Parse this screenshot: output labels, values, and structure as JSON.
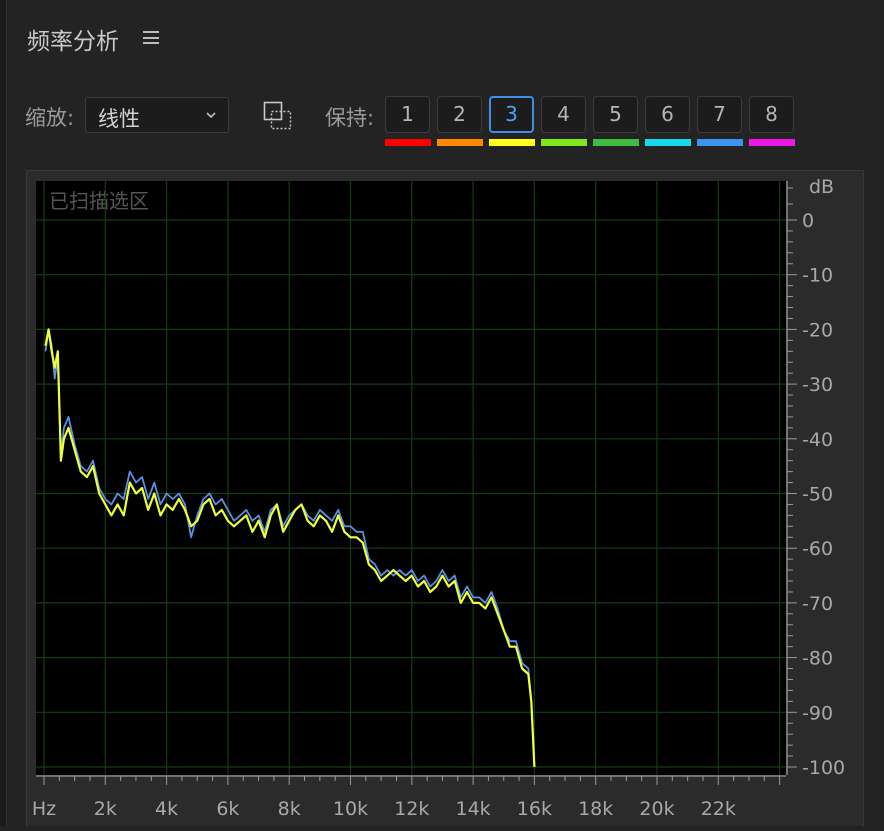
{
  "panel": {
    "title": "频率分析"
  },
  "toolbar": {
    "zoom_label": "缩放:",
    "zoom_value": "线性",
    "hold_label": "保持:",
    "hold_buttons": [
      {
        "label": "1",
        "color": "#ff0000"
      },
      {
        "label": "2",
        "color": "#ff8a00"
      },
      {
        "label": "3",
        "color": "#ffff1e",
        "active": true
      },
      {
        "label": "4",
        "color": "#7fe81a"
      },
      {
        "label": "5",
        "color": "#3fbd3f"
      },
      {
        "label": "6",
        "color": "#18d8f0"
      },
      {
        "label": "7",
        "color": "#3d94ee"
      },
      {
        "label": "8",
        "color": "#ee18e6"
      }
    ]
  },
  "plot": {
    "overlay_label": "已扫描选区"
  },
  "chart_data": {
    "type": "line",
    "xlabel": "Hz",
    "ylabel": "dB",
    "xlim": [
      0,
      24000
    ],
    "ylim": [
      -100,
      0
    ],
    "x_ticks": [
      "Hz",
      "2k",
      "4k",
      "6k",
      "8k",
      "10k",
      "12k",
      "14k",
      "16k",
      "18k",
      "20k",
      "22k"
    ],
    "y_ticks": [
      "0",
      "-10",
      "-20",
      "-30",
      "-40",
      "-50",
      "-60",
      "-70",
      "-80",
      "-90",
      "-100"
    ],
    "grid": true,
    "series": [
      {
        "color": "#5b8fe0",
        "x": [
          50,
          150,
          250,
          350,
          450,
          550,
          650,
          800,
          1000,
          1200,
          1400,
          1600,
          1800,
          2000,
          2200,
          2400,
          2600,
          2800,
          3000,
          3200,
          3400,
          3600,
          3800,
          4000,
          4200,
          4400,
          4600,
          4800,
          5000,
          5200,
          5400,
          5600,
          5800,
          6000,
          6200,
          6400,
          6600,
          6800,
          7000,
          7200,
          7400,
          7600,
          7800,
          8000,
          8200,
          8400,
          8600,
          8800,
          9000,
          9200,
          9400,
          9600,
          9800,
          10000,
          10200,
          10400,
          10600,
          10800,
          11000,
          11200,
          11400,
          11600,
          11800,
          12000,
          12200,
          12400,
          12600,
          12800,
          13000,
          13200,
          13400,
          13600,
          13800,
          14000,
          14200,
          14400,
          14600,
          14800,
          15000,
          15200,
          15400,
          15600,
          15800,
          15900,
          16000
        ],
        "values": [
          -24,
          -20,
          -23,
          -29,
          -25,
          -43,
          -38,
          -36,
          -41,
          -45,
          -46,
          -44,
          -49,
          -51,
          -52,
          -50,
          -51,
          -46,
          -48,
          -47,
          -51,
          -48,
          -52,
          -50,
          -51,
          -50,
          -52,
          -58,
          -54,
          -51,
          -50,
          -52,
          -51,
          -53,
          -55,
          -54,
          -53,
          -55,
          -54,
          -57,
          -53,
          -52,
          -56,
          -54,
          -53,
          -52,
          -54,
          -55,
          -53,
          -54,
          -55,
          -53,
          -56,
          -56,
          -57,
          -57,
          -62,
          -63,
          -65,
          -64,
          -65,
          -64,
          -65,
          -64,
          -66,
          -65,
          -67,
          -66,
          -64,
          -66,
          -65,
          -69,
          -67,
          -69,
          -69,
          -70,
          -68,
          -71,
          -75,
          -77,
          -77,
          -81,
          -82,
          -88,
          -100
        ]
      },
      {
        "color": "#efff3a",
        "x": [
          50,
          150,
          250,
          350,
          450,
          550,
          650,
          800,
          1000,
          1200,
          1400,
          1600,
          1800,
          2000,
          2200,
          2400,
          2600,
          2800,
          3000,
          3200,
          3400,
          3600,
          3800,
          4000,
          4200,
          4400,
          4600,
          4800,
          5000,
          5200,
          5400,
          5600,
          5800,
          6000,
          6200,
          6400,
          6600,
          6800,
          7000,
          7200,
          7400,
          7600,
          7800,
          8000,
          8200,
          8400,
          8600,
          8800,
          9000,
          9200,
          9400,
          9600,
          9800,
          10000,
          10200,
          10400,
          10600,
          10800,
          11000,
          11200,
          11400,
          11600,
          11800,
          12000,
          12200,
          12400,
          12600,
          12800,
          13000,
          13200,
          13400,
          13600,
          13800,
          14000,
          14200,
          14400,
          14600,
          14800,
          15000,
          15200,
          15400,
          15600,
          15800,
          15900,
          16000
        ],
        "values": [
          -23,
          -20,
          -24,
          -27,
          -24,
          -44,
          -40,
          -38,
          -42,
          -46,
          -47,
          -45,
          -50,
          -52,
          -54,
          -52,
          -54,
          -48,
          -50,
          -49,
          -53,
          -50,
          -54,
          -52,
          -53,
          -51,
          -53,
          -56,
          -55,
          -52,
          -51,
          -54,
          -53,
          -55,
          -56,
          -55,
          -54,
          -57,
          -55,
          -58,
          -54,
          -52,
          -57,
          -55,
          -53,
          -52,
          -55,
          -56,
          -54,
          -55,
          -57,
          -54,
          -57,
          -58,
          -58,
          -59,
          -63,
          -64,
          -66,
          -65,
          -64,
          -65,
          -66,
          -65,
          -67,
          -66,
          -68,
          -67,
          -65,
          -67,
          -66,
          -70,
          -68,
          -70,
          -70,
          -71,
          -69,
          -72,
          -75,
          -78,
          -78,
          -82,
          -83,
          -88,
          -100
        ]
      }
    ]
  }
}
